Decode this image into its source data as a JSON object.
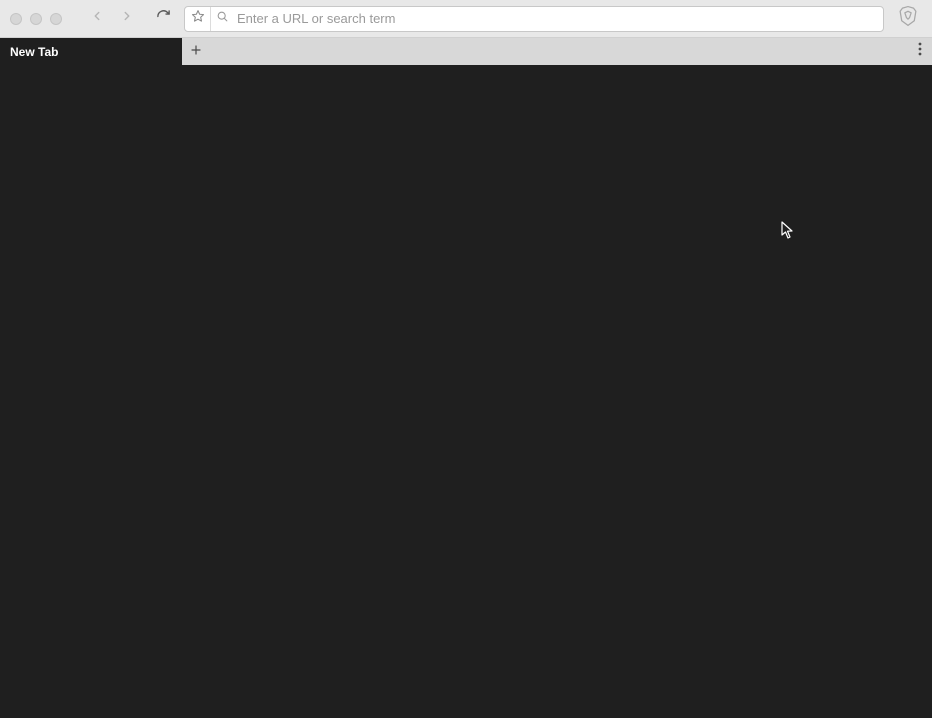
{
  "toolbar": {
    "url_value": "",
    "url_placeholder": "Enter a URL or search term"
  },
  "tabs": {
    "active_label": "New Tab"
  }
}
